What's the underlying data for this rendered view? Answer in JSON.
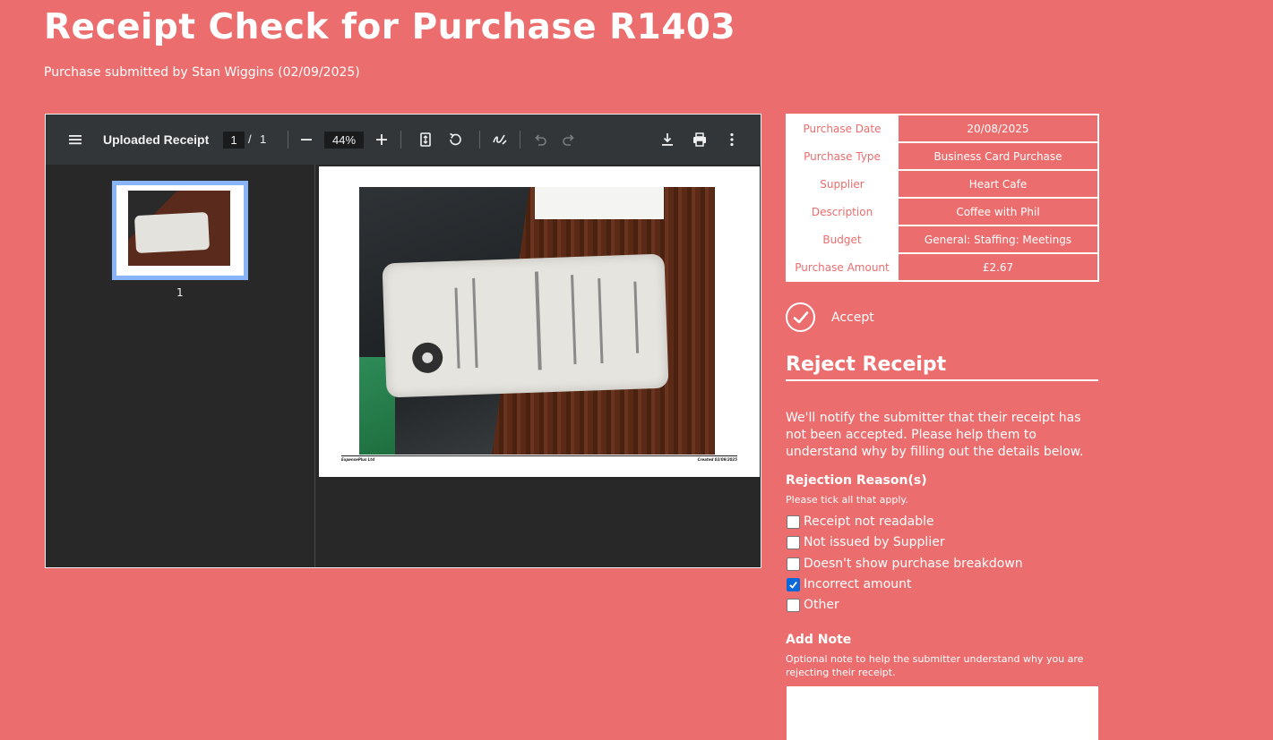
{
  "header": {
    "title": "Receipt Check for Purchase R1403",
    "subtitle": "Purchase submitted by Stan Wiggins (02/09/2025)"
  },
  "viewer": {
    "doc_title": "Uploaded Receipt",
    "current_page": "1",
    "page_sep": "/",
    "total_pages": "1",
    "zoom": "44%",
    "thumb_label": "1",
    "footer_left": "ExpensePlus Ltd",
    "footer_right": "Created 02/09/2025",
    "icons": [
      "menu-icon",
      "zoom-out-icon",
      "zoom-in-icon",
      "fit-page-icon",
      "rotate-icon",
      "annotate-icon",
      "undo-icon",
      "redo-icon",
      "download-icon",
      "print-icon",
      "more-icon"
    ]
  },
  "details": {
    "rows": [
      {
        "label": "Purchase Date",
        "value": "20/08/2025"
      },
      {
        "label": "Purchase Type",
        "value": "Business Card Purchase"
      },
      {
        "label": "Supplier",
        "value": "Heart Cafe"
      },
      {
        "label": "Description",
        "value": "Coffee with Phil"
      },
      {
        "label": "Budget",
        "value": "General: Staffing: Meetings"
      },
      {
        "label": "Purchase Amount",
        "value": "£2.67"
      }
    ]
  },
  "accept": {
    "label": "Accept"
  },
  "reject": {
    "title": "Reject Receipt",
    "intro": "We'll notify the submitter that their receipt has not been accepted. Please help them to understand why by filling out the details below.",
    "reasons_title": "Rejection Reason(s)",
    "reasons_hint": "Please tick all that apply.",
    "reasons": [
      {
        "label": "Receipt not readable",
        "checked": false
      },
      {
        "label": "Not issued by Supplier",
        "checked": false
      },
      {
        "label": "Doesn't show purchase breakdown",
        "checked": false
      },
      {
        "label": "Incorrect amount",
        "checked": true
      },
      {
        "label": "Other",
        "checked": false
      }
    ],
    "note_title": "Add Note",
    "note_hint": "Optional note to help the submitter understand why you are rejecting their receipt.",
    "note_value": ""
  },
  "colors": {
    "background": "#ec6d6e",
    "viewer_toolbar": "#323639",
    "viewer_bg": "#282828",
    "thumb_highlight": "#8ab4f8",
    "checkbox_checked": "#0b68d9"
  }
}
